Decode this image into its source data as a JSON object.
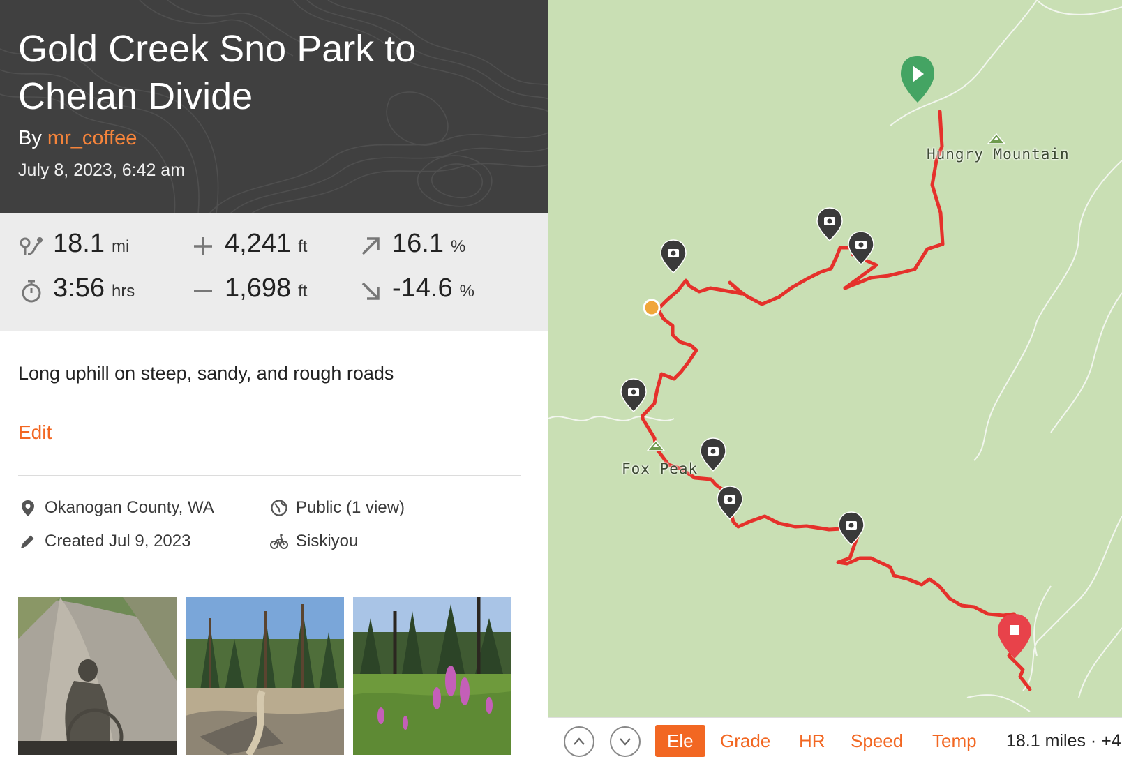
{
  "route": {
    "title": "Gold Creek Sno Park to Chelan Divide",
    "by_label": "By",
    "author": "mr_coffee",
    "date": "July 8, 2023, 6:42 am"
  },
  "stats": {
    "distance": {
      "value": "18.1",
      "unit": "mi",
      "icon": "route-distance-icon"
    },
    "elevation_gain": {
      "value": "4,241",
      "unit": "ft",
      "icon": "plus-icon"
    },
    "max_grade": {
      "value": "16.1",
      "unit": "%",
      "icon": "arrow-up-right-icon"
    },
    "duration": {
      "value": "3:56",
      "unit": "hrs",
      "icon": "stopwatch-icon"
    },
    "elevation_loss": {
      "value": "1,698",
      "unit": "ft",
      "icon": "minus-icon"
    },
    "min_grade": {
      "value": "-14.6",
      "unit": "%",
      "icon": "arrow-down-right-icon"
    }
  },
  "description": "Long uphill on steep, sandy, and rough roads",
  "edit_label": "Edit",
  "meta": {
    "location": "Okanogan County, WA",
    "visibility": "Public (1 view)",
    "created": "Created Jul 9, 2023",
    "bike": "Siskiyou"
  },
  "photos": [
    "gravel-road-shadow-photo",
    "forest-trail-photo",
    "fireweed-meadow-photo"
  ],
  "map": {
    "labels": {
      "hungry_mountain": "Hungry Mountain",
      "fox_peak": "Fox Peak"
    }
  },
  "chart_bar": {
    "modes": [
      "Ele",
      "Grade",
      "HR",
      "Speed",
      "Temp"
    ],
    "active_mode": "Ele",
    "summary": "18.1 miles · +4"
  },
  "colors": {
    "accent": "#f26722",
    "author": "#f5843b",
    "route": "#e5312b",
    "map_bg": "#c9dfb4",
    "header_bg": "#404040",
    "start_pin": "#44a463",
    "end_pin": "#e8424a"
  }
}
